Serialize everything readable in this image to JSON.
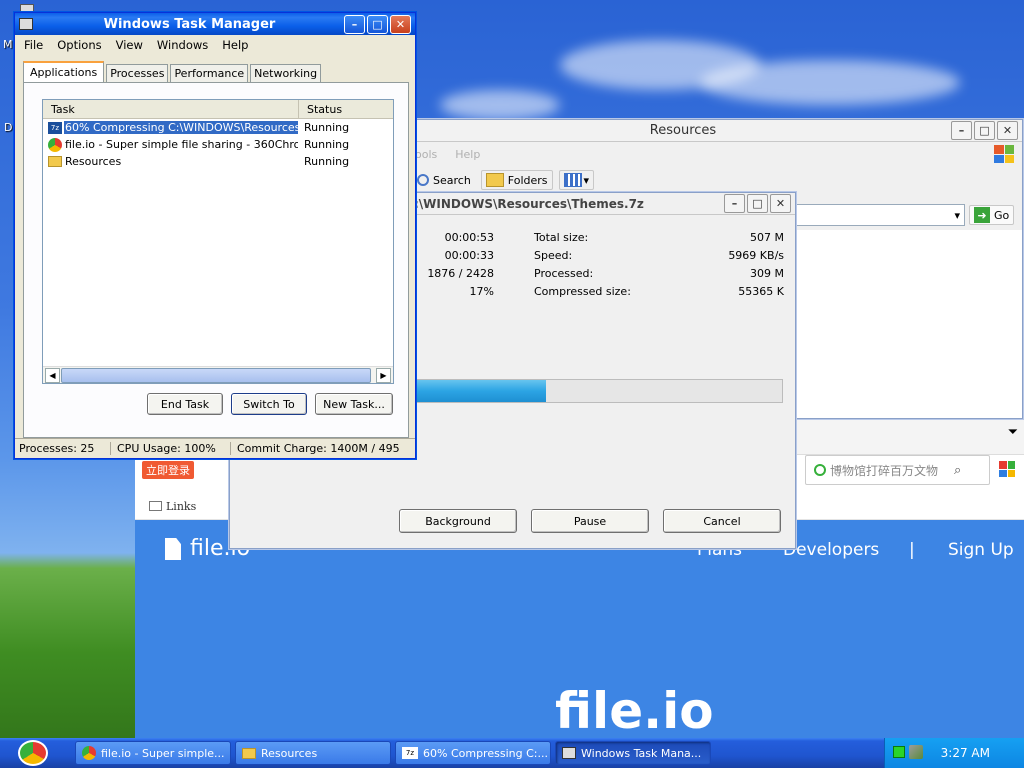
{
  "desktop": {
    "left_letter_1": "M",
    "left_letter_2": "D"
  },
  "task_manager": {
    "title": "Windows Task Manager",
    "menu": [
      "File",
      "Options",
      "View",
      "Windows",
      "Help"
    ],
    "tabs": [
      "Applications",
      "Processes",
      "Performance",
      "Networking"
    ],
    "columns": [
      "Task",
      "Status"
    ],
    "rows": [
      {
        "icon": "7zip-icon",
        "task": "60% Compressing C:\\WINDOWS\\Resources\\...",
        "status": "Running"
      },
      {
        "icon": "browser-icon",
        "task": "file.io - Super simple file sharing - 360Chrome ...",
        "status": "Running"
      },
      {
        "icon": "folder-icon",
        "task": "Resources",
        "status": "Running"
      }
    ],
    "buttons": {
      "end_task": "End Task",
      "switch_to": "Switch To",
      "new_task": "New Task..."
    },
    "status": {
      "processes": "Processes: 25",
      "cpu": "CPU Usage: 100%",
      "commit": "Commit Charge: 1400M / 495"
    }
  },
  "explorer": {
    "title": "Resources",
    "menu_partial": [
      "ools",
      "Help"
    ],
    "search_label": "Search",
    "folders_label": "Folders",
    "go_label": "Go"
  },
  "zip_dialog": {
    "title": ":\\WINDOWS\\Resources\\Themes.7z",
    "left_values": [
      "00:00:53",
      "00:00:33",
      "1876 / 2428",
      "17%"
    ],
    "right_labels": [
      "Total size:",
      "Speed:",
      "Processed:",
      "Compressed size:"
    ],
    "right_values": [
      "507 M",
      "5969 KB/s",
      "309 M",
      "55365 K"
    ],
    "progress": 0.6,
    "buttons": {
      "background": "Background",
      "pause": "Pause",
      "cancel": "Cancel"
    }
  },
  "browser": {
    "login_badge": "立即登录",
    "links_label": "Links",
    "search_placeholder": "博物馆打碎百万文物",
    "logo_small": "file.io",
    "nav": [
      "Plans",
      "Developers",
      "|",
      "Sign Up"
    ],
    "hero_logo": "file.io"
  },
  "taskbar": {
    "items": [
      {
        "icon": "browser-icon",
        "label": "file.io - Super simple..."
      },
      {
        "icon": "folder-icon",
        "label": "Resources"
      },
      {
        "icon": "7zip-icon",
        "label": "60% Compressing C:..."
      },
      {
        "icon": "taskmgr-icon",
        "label": "Windows Task Mana..."
      }
    ],
    "clock": "3:27 AM"
  }
}
